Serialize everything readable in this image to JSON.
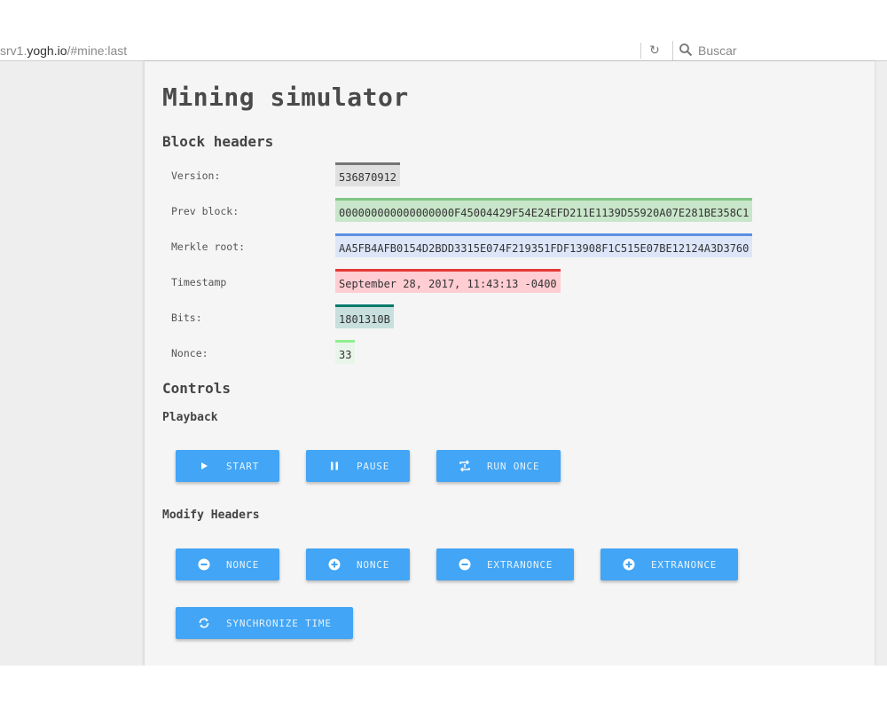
{
  "browser": {
    "url_prefix": "srv1.",
    "url_host": "yogh.io",
    "url_path": "/#mine:last",
    "reload_glyph": "↻",
    "search_placeholder": "Buscar"
  },
  "page": {
    "title": "Mining simulator",
    "block_headers_heading": "Block headers",
    "controls_heading": "Controls",
    "playback_heading": "Playback",
    "modify_heading": "Modify Headers"
  },
  "headers": {
    "version": {
      "label": "Version:",
      "value": "536870912",
      "color": "#e0e0e0",
      "accent": "#757575"
    },
    "prev_block": {
      "label": "Prev block:",
      "value": "000000000000000000F45004429F54E24EFD211E1139D55920A07E281BE358C1",
      "color": "#c8e6c9",
      "accent": "#81c784"
    },
    "merkle_root": {
      "label": "Merkle root:",
      "value": "AA5FB4AFB0154D2BDD3315E074F219351FDF13908F1C515E07BE12124A3D3760",
      "color": "#dde6f9",
      "accent": "#5b8fe0"
    },
    "timestamp": {
      "label": "Timestamp",
      "value": "September 28, 2017, 11:43:13 -0400",
      "color": "#ffcdd2",
      "accent": "#e53935"
    },
    "bits": {
      "label": "Bits:",
      "value": "1801310B",
      "color": "#c8e0dd",
      "accent": "#00796b"
    },
    "nonce": {
      "label": "Nonce:",
      "value": "33",
      "color": "#e8f5e9",
      "accent": "#90ee90"
    }
  },
  "controls": {
    "start": {
      "label": "START",
      "icon": "play-icon"
    },
    "pause": {
      "label": "PAUSE",
      "icon": "pause-icon"
    },
    "run_once": {
      "label": "RUN ONCE",
      "icon": "repeat-once-icon"
    },
    "nonce_minus": {
      "label": "NONCE",
      "icon": "minus-circle-icon"
    },
    "nonce_plus": {
      "label": "NONCE",
      "icon": "plus-circle-icon"
    },
    "extranonce_minus": {
      "label": "EXTRANONCE",
      "icon": "minus-circle-icon"
    },
    "extranonce_plus": {
      "label": "EXTRANONCE",
      "icon": "plus-circle-icon"
    },
    "sync_time": {
      "label": "SYNCHRONIZE TIME",
      "icon": "sync-icon"
    }
  },
  "colors": {
    "button": "#42a5f5",
    "button_text": "#e6f2fb"
  }
}
